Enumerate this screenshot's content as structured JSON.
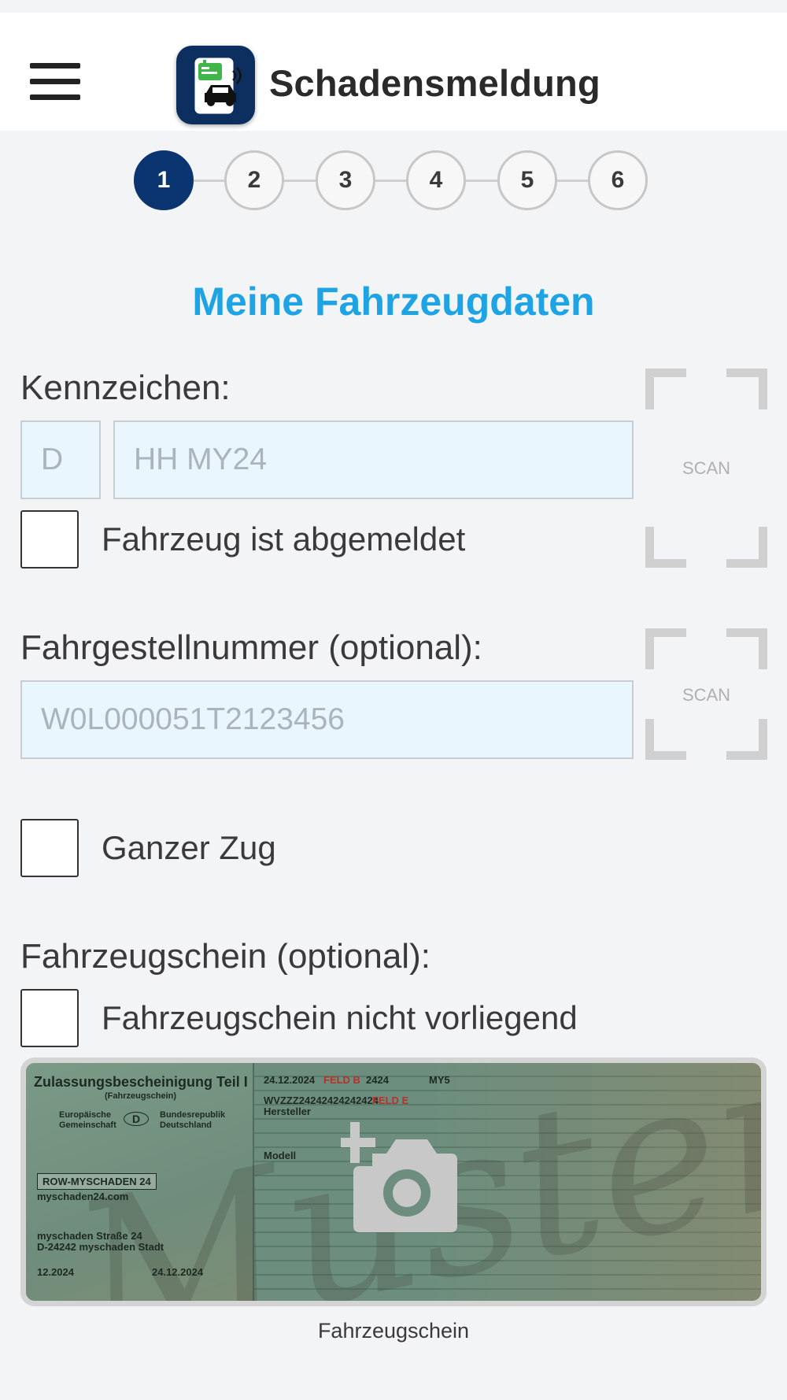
{
  "app": {
    "title": "Schadensmeldung",
    "menu_icon": "hamburger-menu-icon",
    "logo_icon": "car-phone-app-icon"
  },
  "stepper": {
    "steps": [
      "1",
      "2",
      "3",
      "4",
      "5",
      "6"
    ],
    "active_step": 1,
    "active_color": "#0b3570"
  },
  "form": {
    "section_title": "Meine Fahrzeugdaten",
    "title_color": "#1ea3e4",
    "kennzeichen": {
      "label": "Kennzeichen:",
      "country_placeholder": "D",
      "plate_placeholder": "HH MY24",
      "scan_label": "SCAN"
    },
    "abgemeldet": {
      "label": "Fahrzeug ist abgemeldet",
      "checked": false
    },
    "fahrgestellnummer": {
      "label": "Fahrgestellnummer (optional):",
      "placeholder": "W0L000051T2123456",
      "scan_label": "SCAN"
    },
    "ganzer_zug": {
      "label": "Ganzer Zug",
      "checked": false
    },
    "fahrzeugschein": {
      "label": "Fahrzeugschein (optional):",
      "nicht_vorliegend_label": "Fahrzeugschein nicht vorliegend",
      "nicht_vorliegend_checked": false,
      "photo_icon": "add-photo-camera-icon",
      "photo_caption": "Fahrzeugschein",
      "doc": {
        "header": "Zulassungsbescheinigung Teil I",
        "sub": "(Fahrzeugschein)",
        "date1": "24.12.2024",
        "feld_b": "FELD B",
        "code1": "2424",
        "code2": "MY5",
        "vin": "WVZZZ24242424242424",
        "feld_e": "FELD E",
        "hersteller": "Hersteller",
        "modell": "Modell",
        "plate": "ROW-MYSCHADEN 24",
        "site": "myschaden24.com",
        "street": "myschaden Straße 24",
        "city": "D-24242 myschaden Stadt",
        "date2": "12.2024",
        "date3": "24.12.2024",
        "watermark": "Muster",
        "eu1": "Europäische",
        "eu2": "Gemeinschaft",
        "country": "D",
        "brd1": "Bundesrepublik",
        "brd2": "Deutschland"
      }
    }
  }
}
